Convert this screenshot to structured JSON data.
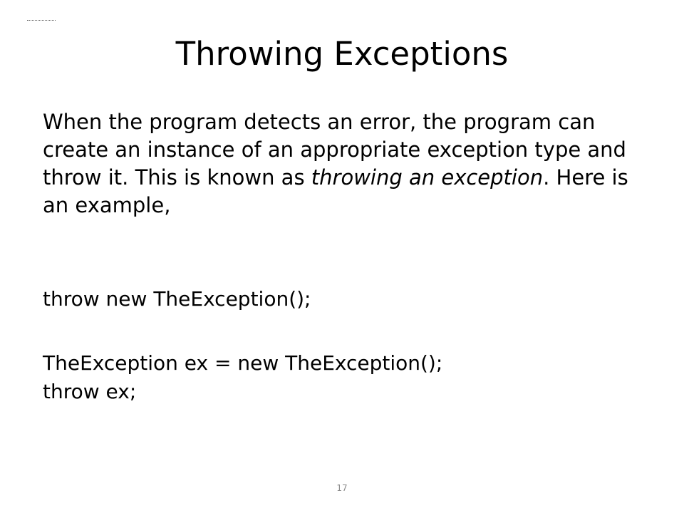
{
  "slide": {
    "title": "Throwing Exceptions",
    "body": {
      "part1": "When the program detects an error, the program can create an instance of an appropriate exception type and throw it. This is known as ",
      "emphasis": "throwing an exception",
      "part2": ". Here is an example,"
    },
    "code_lines": [
      "throw new TheException();",
      "TheException ex = new TheException();",
      "throw ex;"
    ],
    "page_number": "17"
  }
}
